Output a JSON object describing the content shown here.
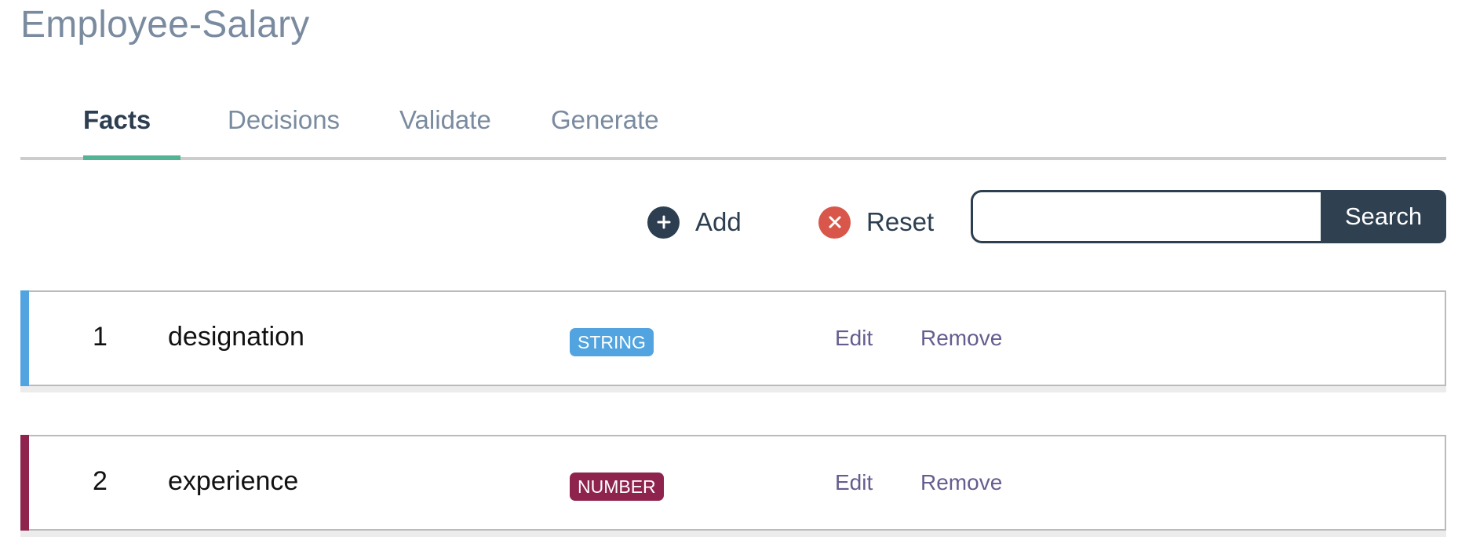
{
  "page": {
    "title": "Employee-Salary"
  },
  "tabs": [
    {
      "label": "Facts",
      "active": true
    },
    {
      "label": "Decisions",
      "active": false
    },
    {
      "label": "Validate",
      "active": false
    },
    {
      "label": "Generate",
      "active": false
    }
  ],
  "toolbar": {
    "add_label": "Add",
    "add_icon": "plus-circle-icon",
    "reset_label": "Reset",
    "reset_icon": "x-circle-icon",
    "search_value": "",
    "search_placeholder": "",
    "search_button_label": "Search"
  },
  "facts": [
    {
      "index": "1",
      "name": "designation",
      "type": "STRING",
      "type_color": "#52a4e0",
      "edit_label": "Edit",
      "remove_label": "Remove"
    },
    {
      "index": "2",
      "name": "experience",
      "type": "NUMBER",
      "type_color": "#8e244d",
      "edit_label": "Edit",
      "remove_label": "Remove"
    }
  ],
  "colors": {
    "accent_tab": "#52b495",
    "primary": "#2c3e50",
    "danger": "#d9574a",
    "link": "#655d8f"
  }
}
